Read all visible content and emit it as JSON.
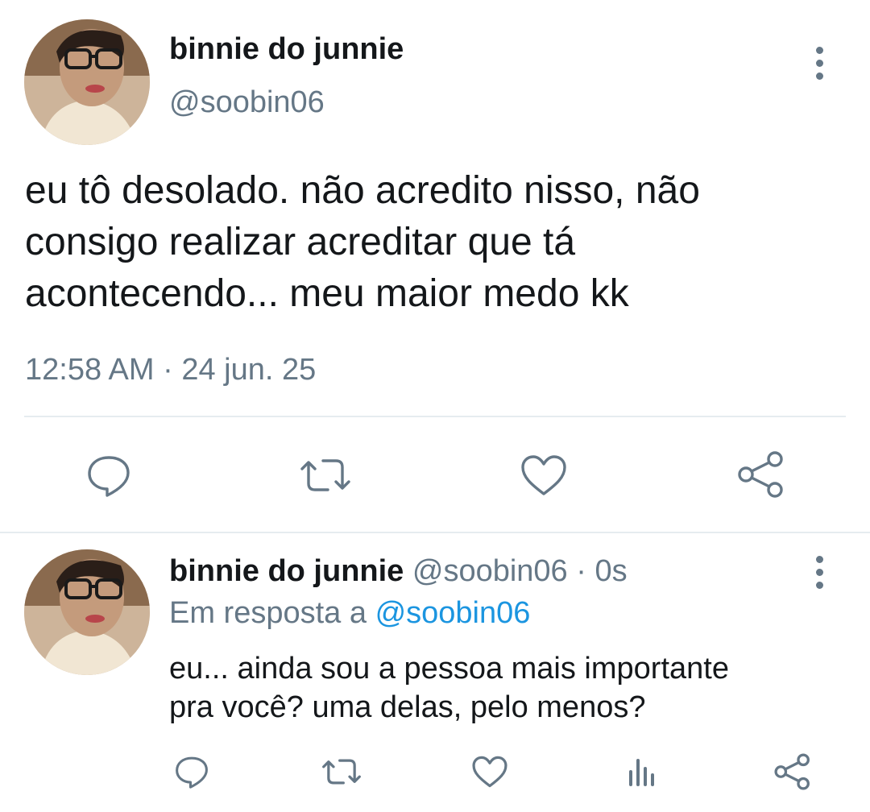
{
  "main_tweet": {
    "author_name": "binnie do junnie",
    "author_handle": "@soobin06",
    "avatar_icon": "profile-photo",
    "text_lines": [
      "eu tô desolado. não acredito nisso, não",
      "consigo realizar acreditar que tá",
      "acontecendo... meu maior medo kk"
    ],
    "timestamp": "12:58 AM · 24 jun. 25",
    "actions": [
      "reply-icon",
      "retweet-icon",
      "like-icon",
      "share-icon"
    ]
  },
  "reply_tweet": {
    "author_name": "binnie do junnie",
    "author_handle": "@soobin06",
    "time": "· 0s",
    "replying_prefix": "Em resposta a",
    "replying_handle": "@soobin06",
    "text_lines": [
      "eu... ainda sou a pessoa mais importante",
      "pra você? uma delas, pelo menos?"
    ],
    "actions": [
      "reply-icon",
      "retweet-icon",
      "like-icon",
      "analytics-icon",
      "share-icon"
    ]
  },
  "colors": {
    "text": "#14171a",
    "muted": "#657786",
    "link": "#1b95e0",
    "divider": "#e6ecf0"
  }
}
